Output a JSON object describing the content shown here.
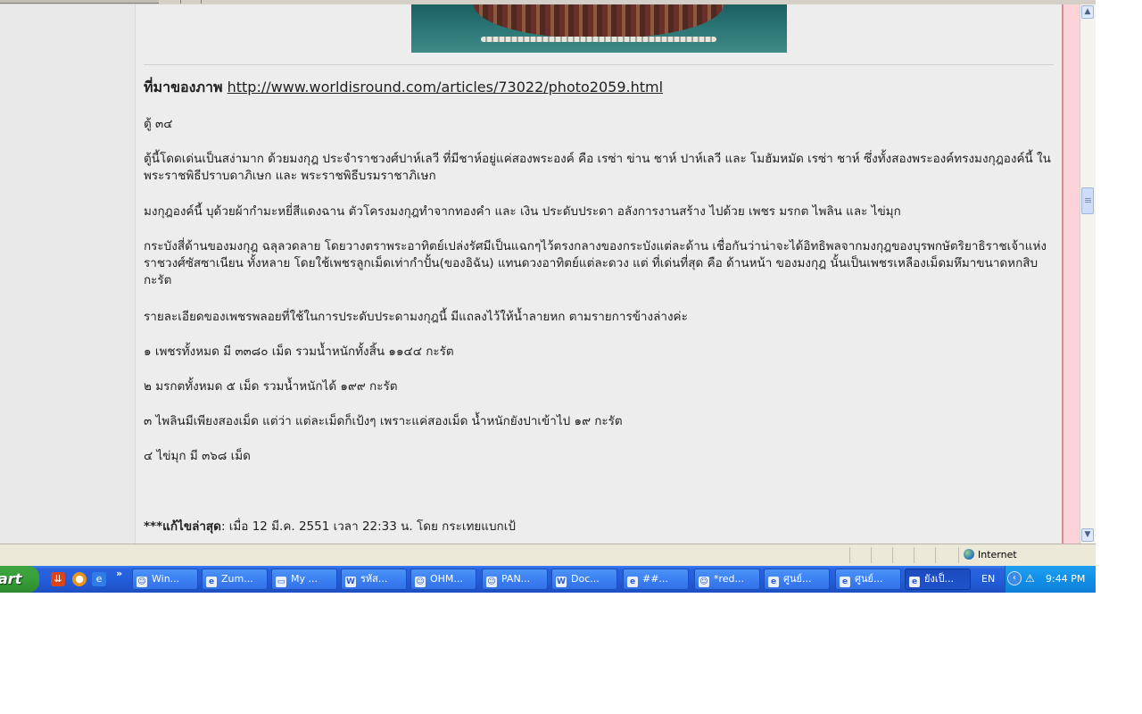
{
  "article": {
    "source_label": "ที่มาของภาพ",
    "source_url": "http://www.worldisround.com/articles/73022/photo2059.html",
    "paragraphs": [
      "ตู้ ๓๔",
      "ตู้นี้โดดเด่นเป็นสง่ามาก ด้วยมงกุฎ ประจำราชวงศ์ปาห์เลวี ที่มีชาห์อยู่แค่สองพระองค์ คือ เรซ่า ข่าน ชาห์ ปาห์เลวี และ โมฮัมหมัด เรซ่า ชาห์ ซึ่งทั้งสองพระองค์ทรงมงกุฎองค์นี้ ในพระราชพิธีปราบดาภิเษก และ พระราชพิธีบรมราชาภิเษก",
      "มงกุฎองค์นี้ บุด้วยผ้ากำมะหยี่สีแดงฉาน ตัวโครงมงกุฎทำจากทองคำ และ เงิน  ประดับประดา อลังการงานสร้าง ไปด้วย เพชร มรกต ไพลิน และ ไข่มุก",
      "กระบังสี่ด้านของมงกุฎ ฉลุลวดลาย  โดยวางตราพระอาทิตย์เปล่งรัศมีเป็นแฉกๆไว้ตรงกลางของกระบังแต่ละด้าน  เชื่อกันว่าน่าจะได้อิทธิพลจากมงกุฎของบุรพกษัตริยาธิราชเจ้าแห่งราชวงศ์ซัสซาเนียน ทั้งหลาย โดยใช้เพชรลูกเม็ดเท่ากำปั้น(ของอิฉัน) แทนดวงอาทิตย์แต่ละดวง แต่ ที่เด่นที่สุด คือ ด้านหน้า ของมงกุฎ นั้นเป็นเพชรเหลืองเม็ดมหึมาขนาดหกสิบกะรัต",
      "รายละเอียดของเพชรพลอยที่ใช้ในการประดับประดามงกุฎนี้ มีแถลงไว้ให้น้ำลายหก ตามรายการข้างล่างค่ะ",
      "๑ เพชรทั้งหมด มี ๓๓๘๐ เม็ด รวมน้ำหนักทั้งสิ้น ๑๑๔๔ กะรัต",
      "๒ มรกตทั้งหมด ๕ เม็ด รวมน้ำหนักได้ ๑๙๙ กะรัต",
      "๓ ไพลินมีเพียงสองเม็ด แต่ว่า แต่ละเม็ดก็เป้งๆ เพราะแค่สองเม็ด น้ำหนักยังปาเข้าไป ๑๙ กะรัต",
      "๔ ไข่มุก มี ๓๖๘ เม็ด"
    ],
    "edited_label": "***แก้ไขล่าสุด",
    "edited_text": ": เมื่อ 12 มี.ค. 2551 เวลา 22:33 น. โดย กระเทยแบกเป้"
  },
  "statusbar": {
    "zone": "Internet"
  },
  "taskbar": {
    "start_label": "art",
    "quicklaunch_more": "»",
    "buttons": [
      {
        "label": "Win...",
        "icon": "users-icon"
      },
      {
        "label": "Zum...",
        "icon": "ie-icon"
      },
      {
        "label": "My ...",
        "icon": "folder-icon"
      },
      {
        "label": "รหัส...",
        "icon": "word-icon"
      },
      {
        "label": "OHM...",
        "icon": "users-icon"
      },
      {
        "label": "PAN...",
        "icon": "users-icon"
      },
      {
        "label": "Doc...",
        "icon": "word-icon"
      },
      {
        "label": "##...",
        "icon": "ie-icon"
      },
      {
        "label": "*red...",
        "icon": "users-icon"
      },
      {
        "label": "ศูนย์...",
        "icon": "ie-icon"
      },
      {
        "label": "ศูนย์...",
        "icon": "ie-icon"
      },
      {
        "label": "ยังเป็...",
        "icon": "ie-icon"
      }
    ],
    "language": "EN",
    "clock": "9:44 PM"
  }
}
